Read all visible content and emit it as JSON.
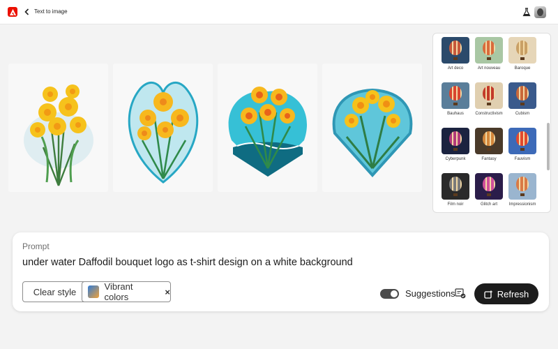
{
  "header": {
    "title": "Text to image",
    "logo_icon": "adobe-logo-icon",
    "back_icon": "chevron-left-icon",
    "labs_icon": "beaker-icon"
  },
  "gallery": {
    "images": [
      {
        "subject": "daffodil-bouquet-1"
      },
      {
        "subject": "daffodil-bouquet-2"
      },
      {
        "subject": "daffodil-bouquet-3"
      },
      {
        "subject": "daffodil-bouquet-4"
      }
    ]
  },
  "styles": {
    "items": [
      {
        "label": "Art deco",
        "color": "#c7583b",
        "bg": "#2b4a6b"
      },
      {
        "label": "Art nouveau",
        "color": "#d96b3c",
        "bg": "#a9c7a4"
      },
      {
        "label": "Baroque",
        "color": "#c9a066",
        "bg": "#e6d6b8"
      },
      {
        "label": "Bauhaus",
        "color": "#d9462f",
        "bg": "#5a7e9a"
      },
      {
        "label": "Constructivism",
        "color": "#c33a2a",
        "bg": "#e0cfb0"
      },
      {
        "label": "Cubism",
        "color": "#c9683a",
        "bg": "#3a5a8c"
      },
      {
        "label": "Cyberpunk",
        "color": "#b13a7a",
        "bg": "#1b2340"
      },
      {
        "label": "Fantasy",
        "color": "#d4873b",
        "bg": "#4a3a2a"
      },
      {
        "label": "Fauvism",
        "color": "#e2492d",
        "bg": "#3d6ab8"
      },
      {
        "label": "Film noir",
        "color": "#7a7a7a",
        "bg": "#2a2a2a"
      },
      {
        "label": "Glitch art",
        "color": "#d04f9a",
        "bg": "#2b1d4a"
      },
      {
        "label": "Impressionism",
        "color": "#d97a45",
        "bg": "#9ab5cf"
      }
    ]
  },
  "prompt": {
    "label": "Prompt",
    "text": "under water Daffodil bouquet logo as t-shirt design on a white background",
    "clear_style_label": "Clear style",
    "chip_label": "Vibrant colors",
    "chip_remove": "×",
    "suggestions_label": "Suggestions",
    "refresh_label": "Refresh",
    "suggestions_enabled": true
  }
}
